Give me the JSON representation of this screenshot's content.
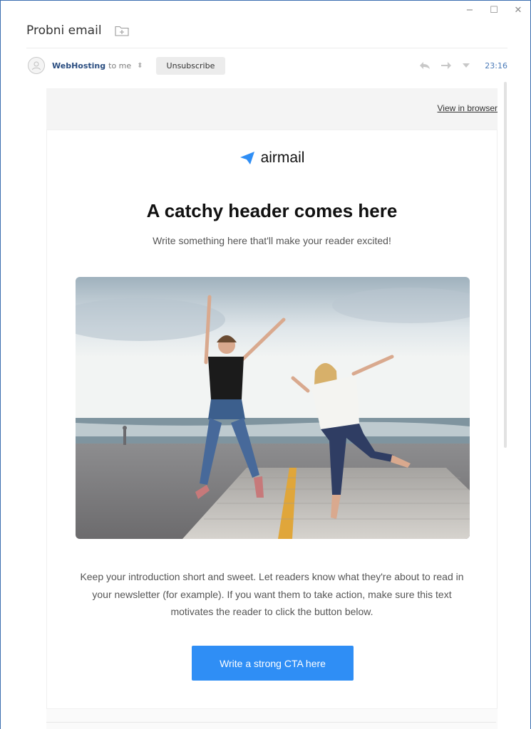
{
  "window": {
    "title": "Probni email",
    "controls": {
      "minimize": "−",
      "maximize": "☐",
      "close": "✕"
    }
  },
  "message": {
    "sender": "WebHosting",
    "recipient": "to me",
    "unsubscribe_label": "Unsubscribe",
    "time": "23:16"
  },
  "email": {
    "view_in_browser": "View in browser",
    "brand": "airmail",
    "headline": "A catchy header comes here",
    "subheadline": "Write something here that'll make your reader excited!",
    "intro": "Keep your introduction short and sweet. Let readers know what they're about to read in your newsletter (for example). If you want them to take action, make sure this text motivates the reader to click the button below.",
    "cta_label": "Write a strong CTA here"
  },
  "colors": {
    "brand_blue": "#2f8ef5",
    "sender_blue": "#2a4d80"
  }
}
